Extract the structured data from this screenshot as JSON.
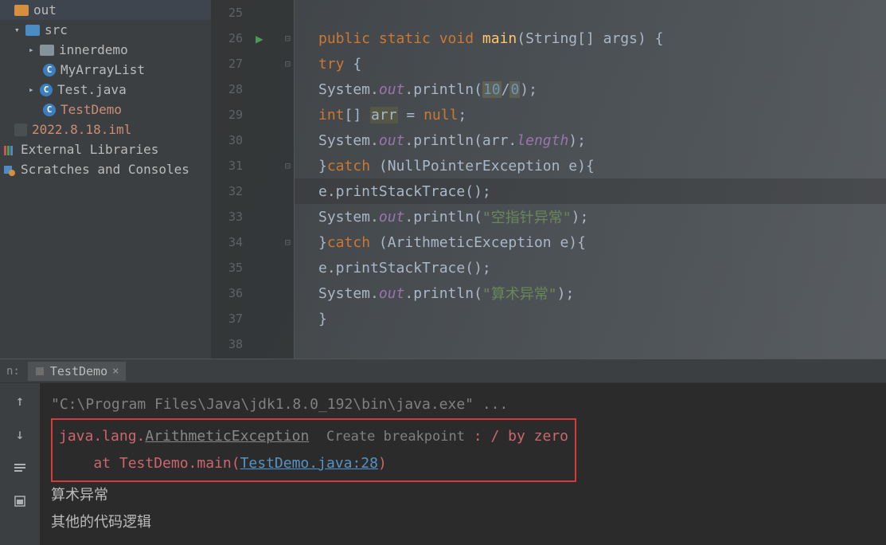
{
  "sidebar": {
    "items": [
      {
        "label": "out",
        "icon": "folder-orange"
      },
      {
        "label": "src",
        "icon": "folder-blue",
        "expanded": true
      },
      {
        "label": "innerdemo",
        "icon": "folder"
      },
      {
        "label": "MyArrayList",
        "icon": "class"
      },
      {
        "label": "Test.java",
        "icon": "class"
      },
      {
        "label": "TestDemo",
        "icon": "class"
      },
      {
        "label": "2022.8.18.iml",
        "icon": "iml"
      },
      {
        "label": "External Libraries"
      },
      {
        "label": "Scratches and Consoles"
      }
    ]
  },
  "editor": {
    "lines": {
      "25": "",
      "26": "    public static void main(String[] args) {",
      "27": "        try {",
      "28": "            System.out.println(10/0);",
      "29": "            int[] arr = null;",
      "30": "            System.out.println(arr.length);",
      "31": "        }catch (NullPointerException e){",
      "32": "            e.printStackTrace();",
      "33": "            System.out.println(\"空指针异常\");",
      "34": "        }catch (ArithmeticException e){",
      "35": "            e.printStackTrace();",
      "36": "            System.out.println(\"算术异常\");",
      "37": "        }",
      "38": ""
    }
  },
  "runTab": {
    "label": "TestDemo",
    "prefix": "n:"
  },
  "console": {
    "cmd": "\"C:\\Program Files\\Java\\jdk1.8.0_192\\bin\\java.exe\" ...",
    "ex_prefix": "java.lang.",
    "ex_name": "ArithmeticException",
    "breakpoint_hint": "Create breakpoint",
    "ex_msg": " : / by zero",
    "at_prefix": "    at TestDemo.main(",
    "at_link": "TestDemo.java:28",
    "at_suffix": ")",
    "out1": "算术异常",
    "out2": "其他的代码逻辑"
  }
}
